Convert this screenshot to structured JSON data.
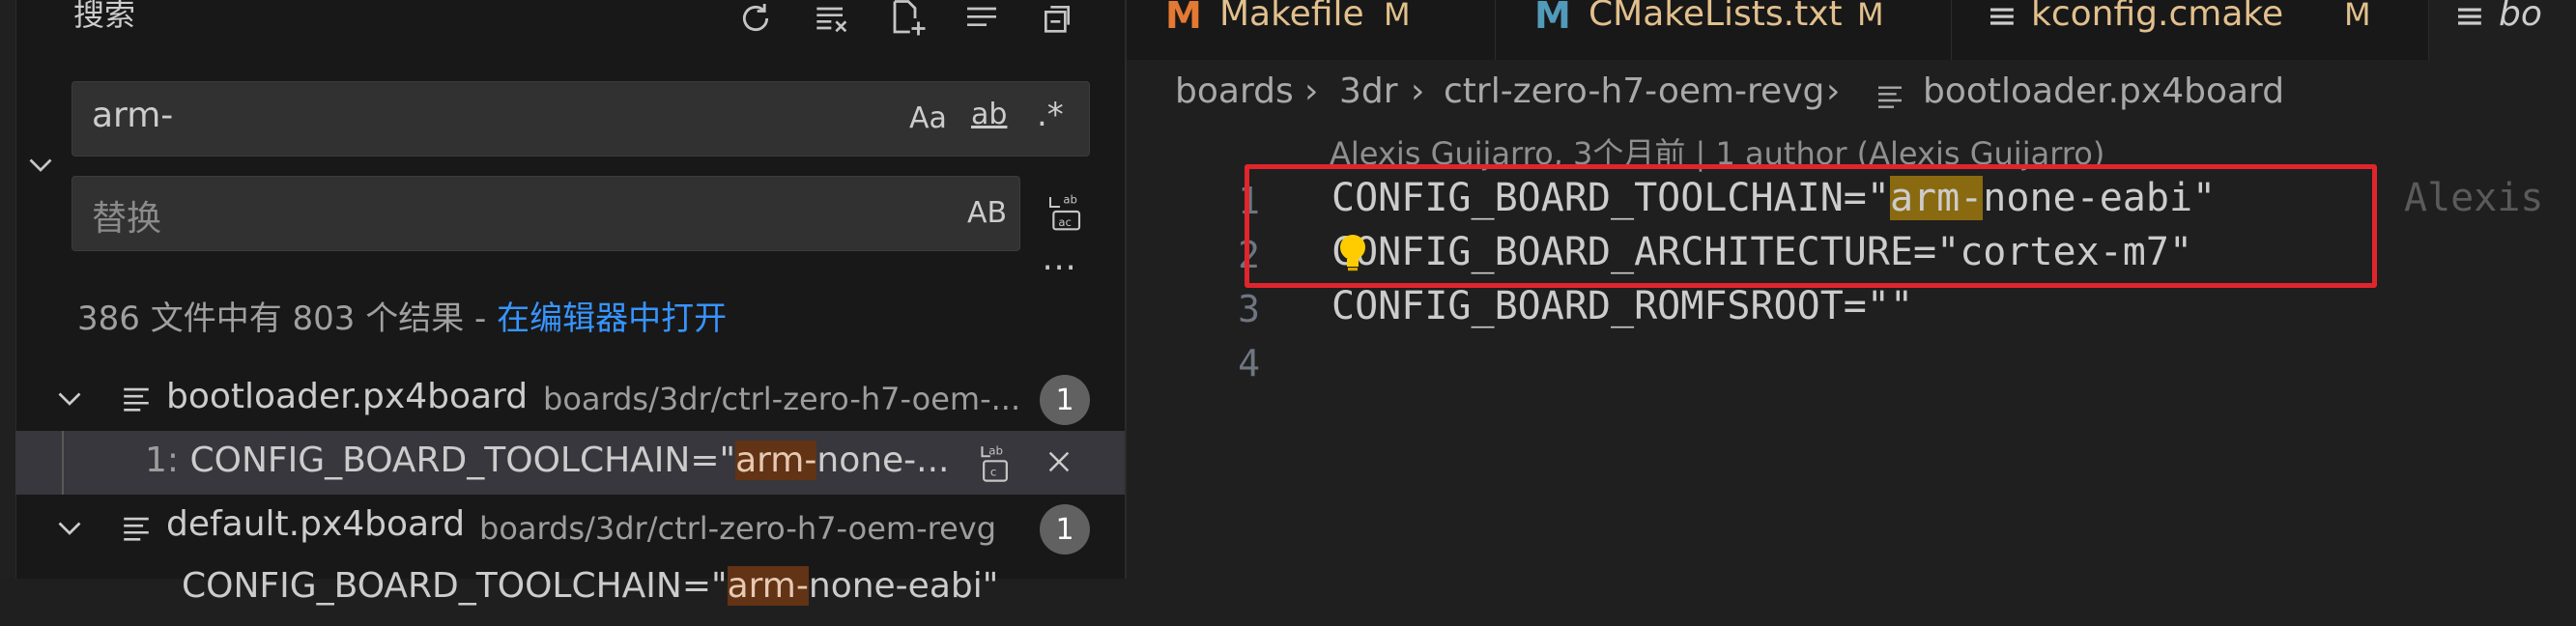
{
  "sidebar": {
    "title": "搜索",
    "toolbar_icons": [
      "refresh-icon",
      "clear-results-icon",
      "new-search-editor-icon",
      "view-as-list-icon",
      "collapse-all-icon"
    ],
    "search": {
      "value": "arm-",
      "options": {
        "match_case": "Aa",
        "whole_word": "ab",
        "regex": ".*"
      }
    },
    "replace": {
      "placeholder": "替换",
      "preserve_case": "AB"
    },
    "more": "⋯",
    "summary": {
      "text": "386 文件中有 803 个结果 - ",
      "link": "在编辑器中打开"
    },
    "files": [
      {
        "name": "bootloader.px4board",
        "path": "boards/3dr/ctrl-zero-h7-oem-...",
        "count": "1",
        "matches": [
          {
            "line": "1:",
            "prefix": "CONFIG_BOARD_TOOLCHAIN=\"",
            "match": "arm-",
            "suffix": "none-..."
          }
        ]
      },
      {
        "name": "default.px4board",
        "path": "boards/3dr/ctrl-zero-h7-oem-revg",
        "count": "1",
        "matches": [
          {
            "line": "",
            "prefix": "CONFIG_BOARD_TOOLCHAIN=\"",
            "match": "arm-",
            "suffix": "none-eabi\""
          }
        ]
      }
    ]
  },
  "tabs": [
    {
      "icon": "M",
      "icon_color": "#e37933",
      "label": "Makefile",
      "status": "M"
    },
    {
      "icon": "M",
      "icon_color": "#519aba",
      "label": "CMakeLists.txt",
      "status": "M"
    },
    {
      "icon": "≡",
      "icon_color": "#cccccc",
      "label": "kconfig.cmake",
      "status": "M"
    },
    {
      "icon": "≡",
      "icon_color": "#cccccc",
      "label": "bo",
      "status": ""
    }
  ],
  "breadcrumb": [
    "boards",
    "3dr",
    "ctrl-zero-h7-oem-revg",
    "bootloader.px4board"
  ],
  "codelens": "Alexis Guijarro, 3个月前 | 1 author (Alexis Guijarro)",
  "code": {
    "lines": [
      {
        "num": "1",
        "pre": "CONFIG_BOARD_TOOLCHAIN=\"",
        "hl": "arm-",
        "post": "none-eabi\""
      },
      {
        "num": "2",
        "pre": "CONFIG_BOARD_ARCHITECTURE=\"cortex-m7\"",
        "hl": "",
        "post": ""
      },
      {
        "num": "3",
        "pre": "CONFIG_BOARD_ROMFSROOT=\"\"",
        "hl": "",
        "post": ""
      },
      {
        "num": "4",
        "pre": "",
        "hl": "",
        "post": ""
      }
    ],
    "inline_blame": "Alexis"
  }
}
